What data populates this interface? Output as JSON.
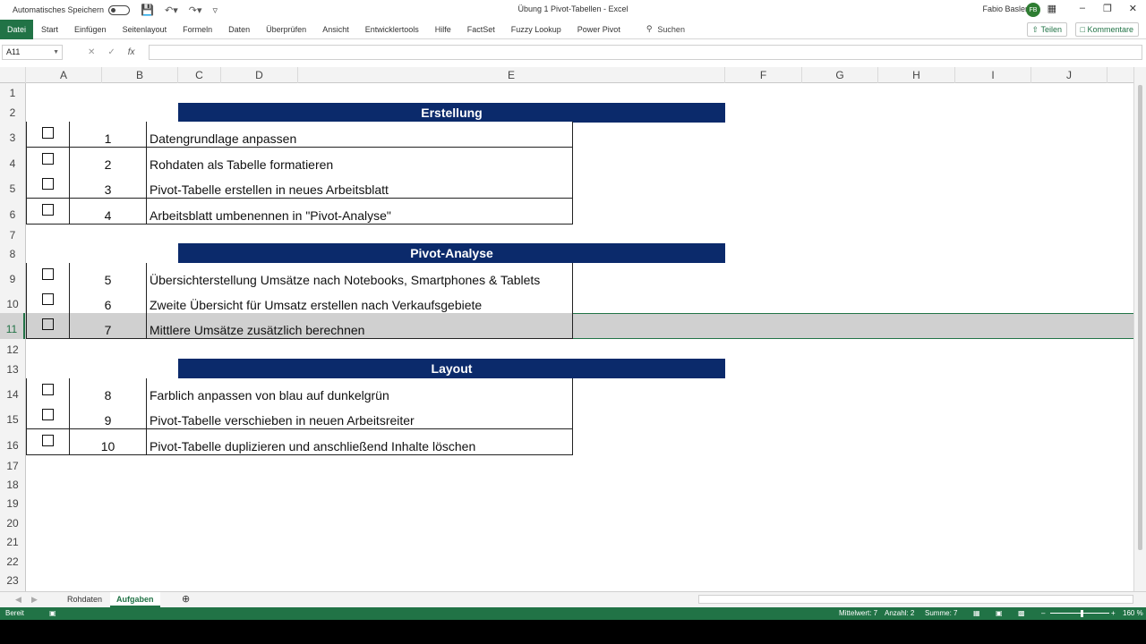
{
  "titlebar": {
    "autosave_label": "Automatisches Speichern",
    "doc_title": "Übung 1 Pivot-Tabellen - Excel",
    "user_name": "Fabio Basler",
    "user_initials": "FB"
  },
  "ribbon": {
    "tabs": [
      "Datei",
      "Start",
      "Einfügen",
      "Seitenlayout",
      "Formeln",
      "Daten",
      "Überprüfen",
      "Ansicht",
      "Entwicklertools",
      "Hilfe",
      "FactSet",
      "Fuzzy Lookup",
      "Power Pivot"
    ],
    "search_label": "Suchen",
    "share_label": "Teilen",
    "comments_label": "Kommentare",
    "accent_color": "#217346"
  },
  "formula_bar": {
    "name_box": "A11",
    "formula": ""
  },
  "columns": [
    "A",
    "B",
    "C",
    "D",
    "E",
    "F",
    "G",
    "H",
    "I",
    "J"
  ],
  "rows": [
    "1",
    "2",
    "3",
    "4",
    "5",
    "6",
    "7",
    "8",
    "9",
    "10",
    "11",
    "12",
    "13",
    "14",
    "15",
    "16",
    "17",
    "18",
    "19",
    "20",
    "21",
    "22",
    "23"
  ],
  "selected_row": "11",
  "sections": [
    {
      "title": "Erstellung",
      "tasks": [
        {
          "num": "1",
          "text": "Datengrundlage anpassen"
        },
        {
          "num": "2",
          "text": "Rohdaten als Tabelle formatieren"
        },
        {
          "num": "3",
          "text": "Pivot-Tabelle erstellen in neues Arbeitsblatt"
        },
        {
          "num": "4",
          "text": "Arbeitsblatt umbenennen in \"Pivot-Analyse\""
        }
      ]
    },
    {
      "title": "Pivot-Analyse",
      "tasks": [
        {
          "num": "5",
          "text": "Übersichterstellung Umsätze nach Notebooks, Smartphones & Tablets"
        },
        {
          "num": "6",
          "text": "Zweite Übersicht für Umsatz erstellen nach Verkaufsgebiete"
        },
        {
          "num": "7",
          "text": "Mittlere Umsätze zusätzlich berechnen"
        }
      ]
    },
    {
      "title": "Layout",
      "tasks": [
        {
          "num": "8",
          "text": "Farblich anpassen von blau auf dunkelgrün"
        },
        {
          "num": "9",
          "text": "Pivot-Tabelle verschieben in neuen Arbeitsreiter"
        },
        {
          "num": "10",
          "text": "Pivot-Tabelle duplizieren und anschließend Inhalte löschen"
        }
      ]
    }
  ],
  "sheet_tabs": [
    "Rohdaten",
    "Aufgaben"
  ],
  "active_sheet": "Aufgaben",
  "statusbar": {
    "ready": "Bereit",
    "average": "Mittelwert: 7",
    "count": "Anzahl: 2",
    "sum": "Summe: 7",
    "zoom": "160 %"
  },
  "colors": {
    "header_fill": "#0b2a6b",
    "excel_green": "#217346"
  }
}
